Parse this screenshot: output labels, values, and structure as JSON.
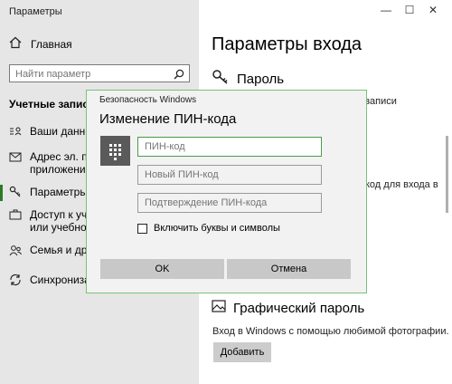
{
  "window": {
    "title": "Параметры",
    "min_glyph": "—",
    "max_glyph": "☐",
    "close_glyph": "✕"
  },
  "sidebar": {
    "home_label": "Главная",
    "search_placeholder": "Найти параметр",
    "section_title": "Учетные записи",
    "items": [
      {
        "icon": "person-card-icon",
        "label": "Ваши данные"
      },
      {
        "icon": "mail-icon",
        "label": "Адрес эл. поч\nприложений"
      },
      {
        "icon": "key-icon",
        "label": "Параметры в"
      },
      {
        "icon": "briefcase-icon",
        "label": "Доступ к учет\nили учебного"
      },
      {
        "icon": "people-icon",
        "label": "Семья и друг"
      },
      {
        "icon": "sync-icon",
        "label": "Синхронизац"
      }
    ],
    "active_index": 2,
    "accent_color": "#2b7a2b"
  },
  "main": {
    "page_title": "Параметры входа",
    "password_heading": "Пароль",
    "fragment_1": "записи",
    "fragment_2": "код для входа в",
    "picture_password_heading": "Графический пароль",
    "picture_password_desc": "Вход в Windows с помощью любимой фотографии.",
    "add_button": "Добавить"
  },
  "dialog": {
    "app_name": "Безопасность Windows",
    "title": "Изменение ПИН-кода",
    "pin_placeholder": "ПИН-код",
    "new_pin_placeholder": "Новый ПИН-код",
    "confirm_pin_placeholder": "Подтверждение ПИН-кода",
    "checkbox_label": "Включить буквы и символы",
    "checkbox_checked": false,
    "ok_label": "OK",
    "cancel_label": "Отмена",
    "border_color": "#7cbf7c"
  }
}
